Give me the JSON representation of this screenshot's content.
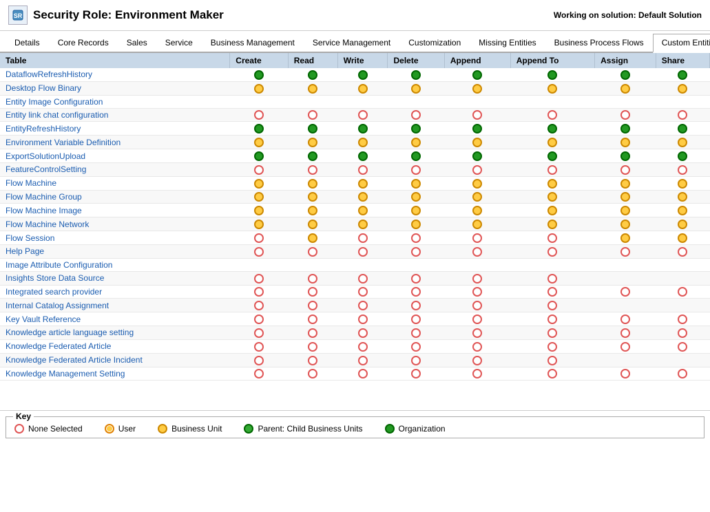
{
  "header": {
    "title": "Security Role: Environment Maker",
    "icon_label": "security-role-icon",
    "working_on": "Working on solution: Default Solution"
  },
  "tabs": [
    {
      "label": "Details",
      "active": false
    },
    {
      "label": "Core Records",
      "active": false
    },
    {
      "label": "Sales",
      "active": false
    },
    {
      "label": "Service",
      "active": false
    },
    {
      "label": "Business Management",
      "active": false
    },
    {
      "label": "Service Management",
      "active": false
    },
    {
      "label": "Customization",
      "active": false
    },
    {
      "label": "Missing Entities",
      "active": false
    },
    {
      "label": "Business Process Flows",
      "active": false
    },
    {
      "label": "Custom Entities",
      "active": true
    }
  ],
  "columns": [
    "Table",
    "Create",
    "Read",
    "Write",
    "Delete",
    "Append",
    "Append To",
    "Assign",
    "Share"
  ],
  "rows": [
    {
      "name": "DataflowRefreshHistory",
      "create": "org",
      "read": "org",
      "write": "org",
      "delete": "org",
      "append": "org",
      "appendTo": "org",
      "assign": "org",
      "share": "org"
    },
    {
      "name": "Desktop Flow Binary",
      "create": "bu",
      "read": "bu",
      "write": "bu",
      "delete": "bu",
      "append": "bu",
      "appendTo": "bu",
      "assign": "bu",
      "share": "bu"
    },
    {
      "name": "Entity Image Configuration",
      "create": "",
      "read": "",
      "write": "",
      "delete": "",
      "append": "",
      "appendTo": "",
      "assign": "",
      "share": ""
    },
    {
      "name": "Entity link chat configuration",
      "create": "none",
      "read": "none",
      "write": "none",
      "delete": "none",
      "append": "none",
      "appendTo": "none",
      "assign": "none",
      "share": "none"
    },
    {
      "name": "EntityRefreshHistory",
      "create": "org",
      "read": "org",
      "write": "org",
      "delete": "org",
      "append": "org",
      "appendTo": "org",
      "assign": "org",
      "share": "org"
    },
    {
      "name": "Environment Variable Definition",
      "create": "bu",
      "read": "bu",
      "write": "bu",
      "delete": "bu",
      "append": "bu",
      "appendTo": "bu",
      "assign": "bu",
      "share": "bu"
    },
    {
      "name": "ExportSolutionUpload",
      "create": "org",
      "read": "org",
      "write": "org",
      "delete": "org",
      "append": "org",
      "appendTo": "org",
      "assign": "org",
      "share": "org"
    },
    {
      "name": "FeatureControlSetting",
      "create": "none",
      "read": "none",
      "write": "none",
      "delete": "none",
      "append": "none",
      "appendTo": "none",
      "assign": "none",
      "share": "none"
    },
    {
      "name": "Flow Machine",
      "create": "bu",
      "read": "bu",
      "write": "bu",
      "delete": "bu",
      "append": "bu",
      "appendTo": "bu",
      "assign": "bu",
      "share": "bu"
    },
    {
      "name": "Flow Machine Group",
      "create": "bu",
      "read": "bu",
      "write": "bu",
      "delete": "bu",
      "append": "bu",
      "appendTo": "bu",
      "assign": "bu",
      "share": "bu"
    },
    {
      "name": "Flow Machine Image",
      "create": "bu",
      "read": "bu",
      "write": "bu",
      "delete": "bu",
      "append": "bu",
      "appendTo": "bu",
      "assign": "bu",
      "share": "bu"
    },
    {
      "name": "Flow Machine Network",
      "create": "bu",
      "read": "bu",
      "write": "bu",
      "delete": "bu",
      "append": "bu",
      "appendTo": "bu",
      "assign": "bu",
      "share": "bu"
    },
    {
      "name": "Flow Session",
      "create": "none",
      "read": "bu",
      "write": "none",
      "delete": "none",
      "append": "none",
      "appendTo": "none",
      "assign": "bu",
      "share": "bu"
    },
    {
      "name": "Help Page",
      "create": "none",
      "read": "none",
      "write": "none",
      "delete": "none",
      "append": "none",
      "appendTo": "none",
      "assign": "none",
      "share": "none"
    },
    {
      "name": "Image Attribute Configuration",
      "create": "",
      "read": "",
      "write": "",
      "delete": "",
      "append": "",
      "appendTo": "",
      "assign": "",
      "share": ""
    },
    {
      "name": "Insights Store Data Source",
      "create": "none",
      "read": "none",
      "write": "none",
      "delete": "none",
      "append": "none",
      "appendTo": "none",
      "assign": "",
      "share": ""
    },
    {
      "name": "Integrated search provider",
      "create": "none",
      "read": "none",
      "write": "none",
      "delete": "none",
      "append": "none",
      "appendTo": "none",
      "assign": "none",
      "share": "none"
    },
    {
      "name": "Internal Catalog Assignment",
      "create": "none",
      "read": "none",
      "write": "none",
      "delete": "none",
      "append": "none",
      "appendTo": "none",
      "assign": "",
      "share": ""
    },
    {
      "name": "Key Vault Reference",
      "create": "none",
      "read": "none",
      "write": "none",
      "delete": "none",
      "append": "none",
      "appendTo": "none",
      "assign": "none",
      "share": "none"
    },
    {
      "name": "Knowledge article language setting",
      "create": "none",
      "read": "none",
      "write": "none",
      "delete": "none",
      "append": "none",
      "appendTo": "none",
      "assign": "none",
      "share": "none"
    },
    {
      "name": "Knowledge Federated Article",
      "create": "none",
      "read": "none",
      "write": "none",
      "delete": "none",
      "append": "none",
      "appendTo": "none",
      "assign": "none",
      "share": "none"
    },
    {
      "name": "Knowledge Federated Article Incident",
      "create": "none",
      "read": "none",
      "write": "none",
      "delete": "none",
      "append": "none",
      "appendTo": "none",
      "assign": "",
      "share": ""
    },
    {
      "name": "Knowledge Management Setting",
      "create": "none",
      "read": "none",
      "write": "none",
      "delete": "none",
      "append": "none",
      "appendTo": "none",
      "assign": "none",
      "share": "none"
    }
  ],
  "key": {
    "title": "Key",
    "items": [
      {
        "label": "None Selected",
        "type": "none"
      },
      {
        "label": "User",
        "type": "user"
      },
      {
        "label": "Business Unit",
        "type": "bu"
      },
      {
        "label": "Parent: Child Business Units",
        "type": "pcbu"
      },
      {
        "label": "Organization",
        "type": "org"
      }
    ]
  }
}
